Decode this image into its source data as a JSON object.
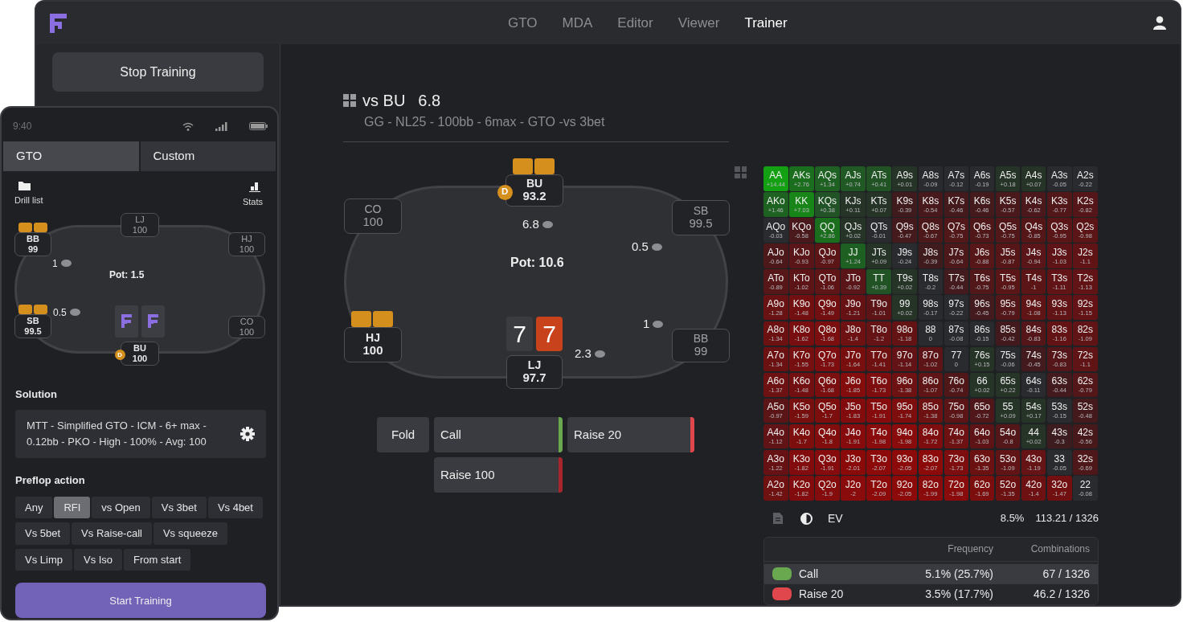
{
  "nav": {
    "items": [
      {
        "label": "GTO",
        "selected": false
      },
      {
        "label": "MDA",
        "selected": false
      },
      {
        "label": "Editor",
        "selected": false
      },
      {
        "label": "Viewer",
        "selected": false
      },
      {
        "label": "Trainer",
        "selected": true
      }
    ]
  },
  "sidebar": {
    "stop_button": "Stop Training"
  },
  "spot": {
    "title": "vs BU",
    "value": "6.8",
    "subtitle": "GG - NL25 - 100bb - 6max - GTO -vs 3bet"
  },
  "table": {
    "pot": "Pot: 10.6",
    "dealer_label": "D",
    "seats": [
      {
        "position": "CO",
        "stack": "100",
        "active": false,
        "cards": false,
        "dealer": false
      },
      {
        "position": "BU",
        "stack": "93.2",
        "active": true,
        "cards": true,
        "dealer": true,
        "bet": "6.8"
      },
      {
        "position": "SB",
        "stack": "99.5",
        "active": false,
        "cards": false,
        "dealer": false,
        "bet": "0.5"
      },
      {
        "position": "HJ",
        "stack": "100",
        "active": true,
        "cards": true,
        "dealer": false
      },
      {
        "position": "LJ",
        "stack": "97.7",
        "active": true,
        "cards": false,
        "dealer": false,
        "bet": "2.3"
      },
      {
        "position": "BB",
        "stack": "99",
        "active": false,
        "cards": false,
        "dealer": false,
        "bet": "1"
      }
    ],
    "hero_cards": [
      {
        "rank": "7",
        "color": "#3b3c40"
      },
      {
        "rank": "7",
        "color": "#c8421c"
      }
    ]
  },
  "actions": [
    {
      "label": "Fold"
    },
    {
      "label": "Call",
      "color": "#6aa84f"
    },
    {
      "label": "Raise 20",
      "color": "#e0474c"
    },
    {
      "label": "Raise 100",
      "color": "#a8262b"
    }
  ],
  "range": {
    "rows": [
      [
        [
          "AA",
          "+14.44"
        ],
        [
          "AKs",
          "+2.76"
        ],
        [
          "AQs",
          "+1.34"
        ],
        [
          "AJs",
          "+0.74"
        ],
        [
          "ATs",
          "+0.41"
        ],
        [
          "A9s",
          "+0.01"
        ],
        [
          "A8s",
          "-0.09"
        ],
        [
          "A7s",
          "-0.12"
        ],
        [
          "A6s",
          "-0.19"
        ],
        [
          "A5s",
          "+0.18"
        ],
        [
          "A4s",
          "+0.07"
        ],
        [
          "A3s",
          "-0.05"
        ],
        [
          "A2s",
          "-0.22"
        ]
      ],
      [
        [
          "AKo",
          "+1.46"
        ],
        [
          "KK",
          "+7.03"
        ],
        [
          "KQs",
          "+0.38"
        ],
        [
          "KJs",
          "+0.11"
        ],
        [
          "KTs",
          "+0.07"
        ],
        [
          "K9s",
          "-0.39"
        ],
        [
          "K8s",
          "-0.54"
        ],
        [
          "K7s",
          "-0.46"
        ],
        [
          "K6s",
          "-0.46"
        ],
        [
          "K5s",
          "-0.57"
        ],
        [
          "K4s",
          "-0.62"
        ],
        [
          "K3s",
          "-0.77"
        ],
        [
          "K2s",
          "-0.82"
        ]
      ],
      [
        [
          "AQo",
          "-0.03"
        ],
        [
          "KQo",
          "-0.58"
        ],
        [
          "QQ",
          "+2.86"
        ],
        [
          "QJs",
          "+0.02"
        ],
        [
          "QTs",
          "-0.01"
        ],
        [
          "Q9s",
          "-0.47"
        ],
        [
          "Q8s",
          "-0.67"
        ],
        [
          "Q7s",
          "-0.75"
        ],
        [
          "Q6s",
          "-0.73"
        ],
        [
          "Q5s",
          "-0.75"
        ],
        [
          "Q4s",
          "-0.85"
        ],
        [
          "Q3s",
          "-0.95"
        ],
        [
          "Q2s",
          "-0.98"
        ]
      ],
      [
        [
          "AJo",
          "-0.64"
        ],
        [
          "KJo",
          "-0.93"
        ],
        [
          "QJo",
          "-0.97"
        ],
        [
          "JJ",
          "+1.24"
        ],
        [
          "JTs",
          "+0.09"
        ],
        [
          "J9s",
          "-0.24"
        ],
        [
          "J8s",
          "-0.39"
        ],
        [
          "J7s",
          "-0.64"
        ],
        [
          "J6s",
          "-0.88"
        ],
        [
          "J5s",
          "-0.87"
        ],
        [
          "J4s",
          "-0.94"
        ],
        [
          "J3s",
          "-1.03"
        ],
        [
          "J2s",
          "-1.1"
        ]
      ],
      [
        [
          "ATo",
          "-0.89"
        ],
        [
          "KTo",
          "-1.02"
        ],
        [
          "QTo",
          "-1.06"
        ],
        [
          "JTo",
          "-0.92"
        ],
        [
          "TT",
          "+0.39"
        ],
        [
          "T9s",
          "+0.02"
        ],
        [
          "T8s",
          "-0.2"
        ],
        [
          "T7s",
          "-0.44"
        ],
        [
          "T6s",
          "-0.75"
        ],
        [
          "T5s",
          "-0.95"
        ],
        [
          "T4s",
          "-1"
        ],
        [
          "T3s",
          "-1.11"
        ],
        [
          "T2s",
          "-1.13"
        ]
      ],
      [
        [
          "A9o",
          "-1.28"
        ],
        [
          "K9o",
          "-1.48"
        ],
        [
          "Q9o",
          "-1.49"
        ],
        [
          "J9o",
          "-1.21"
        ],
        [
          "T9o",
          "-1.01"
        ],
        [
          "99",
          "+0.02"
        ],
        [
          "98s",
          "-0.17"
        ],
        [
          "97s",
          "-0.22"
        ],
        [
          "96s",
          "-0.45"
        ],
        [
          "95s",
          "-0.79"
        ],
        [
          "94s",
          "-1.08"
        ],
        [
          "93s",
          "-1.13"
        ],
        [
          "92s",
          "-1.15"
        ]
      ],
      [
        [
          "A8o",
          "-1.34"
        ],
        [
          "K8o",
          "-1.62"
        ],
        [
          "Q8o",
          "-1.68"
        ],
        [
          "J8o",
          "-1.4"
        ],
        [
          "T8o",
          "-1.2"
        ],
        [
          "98o",
          "-1.18"
        ],
        [
          "88",
          "0"
        ],
        [
          "87s",
          "-0.08"
        ],
        [
          "86s",
          "-0.15"
        ],
        [
          "85s",
          "-0.42"
        ],
        [
          "84s",
          "-0.83"
        ],
        [
          "83s",
          "-1.16"
        ],
        [
          "82s",
          "-1.09"
        ]
      ],
      [
        [
          "A7o",
          "-1.34"
        ],
        [
          "K7o",
          "-1.55"
        ],
        [
          "Q7o",
          "-1.73"
        ],
        [
          "J7o",
          "-1.64"
        ],
        [
          "T7o",
          "-1.41"
        ],
        [
          "97o",
          "-1.14"
        ],
        [
          "87o",
          "-1.02"
        ],
        [
          "77",
          "0"
        ],
        [
          "76s",
          "+0.15"
        ],
        [
          "75s",
          "-0.06"
        ],
        [
          "74s",
          "-0.45"
        ],
        [
          "73s",
          "-0.83"
        ],
        [
          "72s",
          "-1.1"
        ]
      ],
      [
        [
          "A6o",
          "-1.37"
        ],
        [
          "K6o",
          "-1.48"
        ],
        [
          "Q6o",
          "-1.68"
        ],
        [
          "J6o",
          "-1.85"
        ],
        [
          "T6o",
          "-1.73"
        ],
        [
          "96o",
          "-1.38"
        ],
        [
          "86o",
          "-1.07"
        ],
        [
          "76o",
          "-0.74"
        ],
        [
          "66",
          "+0.02"
        ],
        [
          "65s",
          "+0.22"
        ],
        [
          "64s",
          "-0.11"
        ],
        [
          "63s",
          "-0.44"
        ],
        [
          "62s",
          "-0.79"
        ]
      ],
      [
        [
          "A5o",
          "-0.97"
        ],
        [
          "K5o",
          "-1.59"
        ],
        [
          "Q5o",
          "-1.7"
        ],
        [
          "J5o",
          "-1.83"
        ],
        [
          "T5o",
          "-1.91"
        ],
        [
          "95o",
          "-1.74"
        ],
        [
          "85o",
          "-1.38"
        ],
        [
          "75o",
          "-0.98"
        ],
        [
          "65o",
          "-0.72"
        ],
        [
          "55",
          "+0.09"
        ],
        [
          "54s",
          "+0.17"
        ],
        [
          "53s",
          "-0.15"
        ],
        [
          "52s",
          "-0.48"
        ]
      ],
      [
        [
          "A4o",
          "-1.12"
        ],
        [
          "K4o",
          "-1.7"
        ],
        [
          "Q4o",
          "-1.8"
        ],
        [
          "J4o",
          "-1.91"
        ],
        [
          "T4o",
          "-1.98"
        ],
        [
          "94o",
          "-1.98"
        ],
        [
          "84o",
          "-1.72"
        ],
        [
          "74o",
          "-1.37"
        ],
        [
          "64o",
          "-1.03"
        ],
        [
          "54o",
          "-0.8"
        ],
        [
          "44",
          "+0.02"
        ],
        [
          "43s",
          "-0.3"
        ],
        [
          "42s",
          "-0.56"
        ]
      ],
      [
        [
          "A3o",
          "-1.22"
        ],
        [
          "K3o",
          "-1.82"
        ],
        [
          "Q3o",
          "-1.91"
        ],
        [
          "J3o",
          "-2.01"
        ],
        [
          "T3o",
          "-2.07"
        ],
        [
          "93o",
          "-2.05"
        ],
        [
          "83o",
          "-2.07"
        ],
        [
          "73o",
          "-1.73"
        ],
        [
          "63o",
          "-1.35"
        ],
        [
          "53o",
          "-1.09"
        ],
        [
          "43o",
          "-1.19"
        ],
        [
          "33",
          "-0.05"
        ],
        [
          "32s",
          "-0.69"
        ]
      ],
      [
        [
          "A2o",
          "-1.42"
        ],
        [
          "K2o",
          "-1.82"
        ],
        [
          "Q2o",
          "-1.9"
        ],
        [
          "J2o",
          "-2"
        ],
        [
          "T2o",
          "-2.09"
        ],
        [
          "92o",
          "-2.05"
        ],
        [
          "82o",
          "-1.99"
        ],
        [
          "72o",
          "-1.98"
        ],
        [
          "62o",
          "-1.69"
        ],
        [
          "52o",
          "-1.35"
        ],
        [
          "42o",
          "-1.4"
        ],
        [
          "32o",
          "-1.47"
        ],
        [
          "22",
          "-0.08"
        ]
      ]
    ],
    "footer": {
      "mode": "EV",
      "percent": "8.5%",
      "combos": "113.21 / 1326"
    },
    "stats": {
      "columns": [
        "Frequency",
        "Combinations"
      ],
      "rows": [
        {
          "action": "Call",
          "color": "#6aa84f",
          "frequency": "5.1% (25.7%)",
          "combinations": "67 / 1326",
          "selected": true
        },
        {
          "action": "Raise 20",
          "color": "#e0474c",
          "frequency": "3.5% (17.7%)",
          "combinations": "46.2 / 1326",
          "selected": false
        }
      ]
    }
  },
  "phone": {
    "time": "9:40",
    "tabs": [
      {
        "label": "GTO",
        "selected": true
      },
      {
        "label": "Custom",
        "selected": false
      }
    ],
    "tools": [
      "Drill list",
      "Stats"
    ],
    "table": {
      "pot": "Pot: 1.5",
      "dealer_label": "D",
      "seats": [
        {
          "position": "LJ",
          "stack": "100",
          "active": false,
          "cards": false,
          "dealer": false
        },
        {
          "position": "BB",
          "stack": "99",
          "active": true,
          "cards": true,
          "dealer": false,
          "bet": "1"
        },
        {
          "position": "HJ",
          "stack": "100",
          "active": false,
          "cards": false,
          "dealer": false
        },
        {
          "position": "SB",
          "stack": "99.5",
          "active": true,
          "cards": true,
          "dealer": false,
          "bet": "0.5"
        },
        {
          "position": "CO",
          "stack": "100",
          "active": false,
          "cards": false,
          "dealer": false
        },
        {
          "position": "BU",
          "stack": "100",
          "active": true,
          "cards": false,
          "dealer": true
        }
      ]
    },
    "solution_label": "Solution",
    "solution": "MTT - Simplified GTO - ICM - 6+ max - 0.12bb - PKO - High - 100% - Avg: 100",
    "preflop_label": "Preflop action",
    "preflop_options": [
      {
        "label": "Any",
        "selected": false
      },
      {
        "label": "RFI",
        "selected": true
      },
      {
        "label": "vs Open",
        "selected": false
      },
      {
        "label": "Vs 3bet",
        "selected": false
      },
      {
        "label": "Vs 4bet",
        "selected": false
      },
      {
        "label": "Vs 5bet",
        "selected": false
      },
      {
        "label": "Vs Raise-call",
        "selected": false
      },
      {
        "label": "Vs squeeze",
        "selected": false
      },
      {
        "label": "Vs Limp",
        "selected": false
      },
      {
        "label": "Vs Iso",
        "selected": false
      },
      {
        "label": "From start",
        "selected": false
      }
    ],
    "start_button": "Start Training"
  }
}
